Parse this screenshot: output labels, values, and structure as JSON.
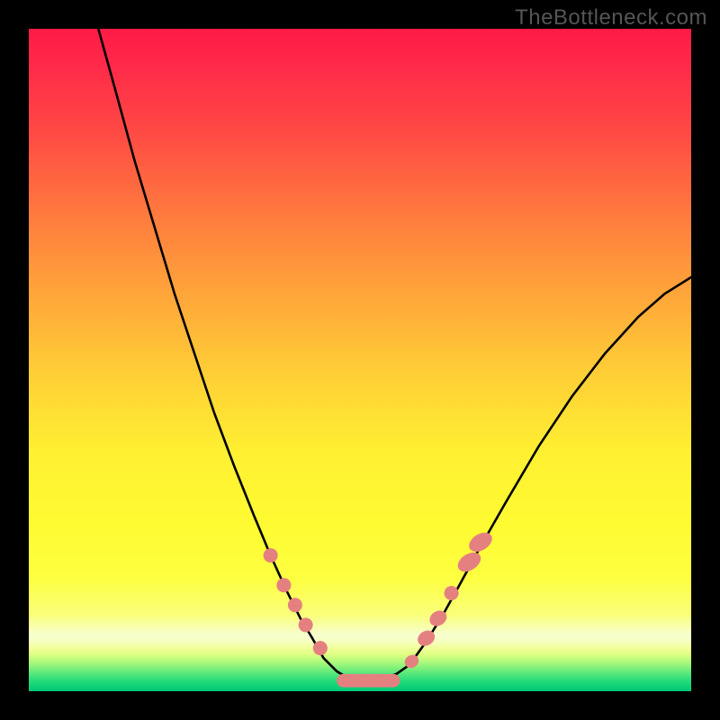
{
  "watermark": "TheBottleneck.com",
  "gradient_stops": [
    {
      "offset": 0.0,
      "color": "#ff1a46"
    },
    {
      "offset": 0.06,
      "color": "#ff2b49"
    },
    {
      "offset": 0.16,
      "color": "#ff4b44"
    },
    {
      "offset": 0.28,
      "color": "#ff7a3e"
    },
    {
      "offset": 0.4,
      "color": "#ffa53a"
    },
    {
      "offset": 0.52,
      "color": "#ffce36"
    },
    {
      "offset": 0.64,
      "color": "#fff032"
    },
    {
      "offset": 0.75,
      "color": "#fffb32"
    },
    {
      "offset": 0.83,
      "color": "#fdff41"
    },
    {
      "offset": 0.885,
      "color": "#faff7b"
    },
    {
      "offset": 0.905,
      "color": "#f8ffb2"
    },
    {
      "offset": 0.915,
      "color": "#f7ffd0"
    },
    {
      "offset": 0.925,
      "color": "#f7ffc0"
    },
    {
      "offset": 0.935,
      "color": "#f2ff9a"
    },
    {
      "offset": 0.946,
      "color": "#d9ff80"
    },
    {
      "offset": 0.958,
      "color": "#a3f77c"
    },
    {
      "offset": 0.972,
      "color": "#5de97a"
    },
    {
      "offset": 0.986,
      "color": "#20d979"
    },
    {
      "offset": 1.0,
      "color": "#00c877"
    }
  ],
  "curve_color": "#000000",
  "marker_color": "#e58080",
  "chart_data": {
    "type": "line",
    "title": "",
    "xlabel": "",
    "ylabel": "",
    "xlim": [
      0,
      1
    ],
    "ylim": [
      0,
      1
    ],
    "series": [
      {
        "name": "left_branch",
        "points": [
          {
            "x": 0.105,
            "y": 1.0
          },
          {
            "x": 0.13,
            "y": 0.91
          },
          {
            "x": 0.16,
            "y": 0.8
          },
          {
            "x": 0.19,
            "y": 0.7
          },
          {
            "x": 0.22,
            "y": 0.6
          },
          {
            "x": 0.25,
            "y": 0.51
          },
          {
            "x": 0.28,
            "y": 0.42
          },
          {
            "x": 0.31,
            "y": 0.34
          },
          {
            "x": 0.34,
            "y": 0.265
          },
          {
            "x": 0.365,
            "y": 0.205
          },
          {
            "x": 0.39,
            "y": 0.15
          },
          {
            "x": 0.41,
            "y": 0.11
          },
          {
            "x": 0.428,
            "y": 0.08
          },
          {
            "x": 0.445,
            "y": 0.05
          },
          {
            "x": 0.465,
            "y": 0.03
          },
          {
            "x": 0.485,
            "y": 0.018
          },
          {
            "x": 0.505,
            "y": 0.015
          }
        ]
      },
      {
        "name": "right_branch",
        "points": [
          {
            "x": 0.505,
            "y": 0.015
          },
          {
            "x": 0.53,
            "y": 0.017
          },
          {
            "x": 0.555,
            "y": 0.026
          },
          {
            "x": 0.575,
            "y": 0.04
          },
          {
            "x": 0.6,
            "y": 0.075
          },
          {
            "x": 0.625,
            "y": 0.115
          },
          {
            "x": 0.65,
            "y": 0.16
          },
          {
            "x": 0.68,
            "y": 0.215
          },
          {
            "x": 0.72,
            "y": 0.285
          },
          {
            "x": 0.77,
            "y": 0.37
          },
          {
            "x": 0.82,
            "y": 0.445
          },
          {
            "x": 0.87,
            "y": 0.51
          },
          {
            "x": 0.92,
            "y": 0.565
          },
          {
            "x": 0.96,
            "y": 0.6
          },
          {
            "x": 1.0,
            "y": 0.625
          }
        ]
      }
    ],
    "markers_left": [
      {
        "x": 0.365,
        "y": 0.205,
        "rx": 8,
        "ry": 8
      },
      {
        "x": 0.385,
        "y": 0.16,
        "rx": 8,
        "ry": 8
      },
      {
        "x": 0.402,
        "y": 0.13,
        "rx": 8,
        "ry": 8
      },
      {
        "x": 0.418,
        "y": 0.1,
        "rx": 8,
        "ry": 8
      },
      {
        "x": 0.44,
        "y": 0.065,
        "rx": 8,
        "ry": 8
      }
    ],
    "markers_right": [
      {
        "x": 0.578,
        "y": 0.045,
        "rx": 7,
        "ry": 8
      },
      {
        "x": 0.6,
        "y": 0.08,
        "rx": 8,
        "ry": 10
      },
      {
        "x": 0.618,
        "y": 0.11,
        "rx": 8,
        "ry": 10
      },
      {
        "x": 0.638,
        "y": 0.148,
        "rx": 8,
        "ry": 8
      },
      {
        "x": 0.665,
        "y": 0.195,
        "rx": 9,
        "ry": 14
      },
      {
        "x": 0.682,
        "y": 0.225,
        "rx": 9,
        "ry": 14
      }
    ],
    "valley_bar": {
      "x0": 0.465,
      "x1": 0.56,
      "y": 0.016,
      "height": 0.02
    }
  }
}
